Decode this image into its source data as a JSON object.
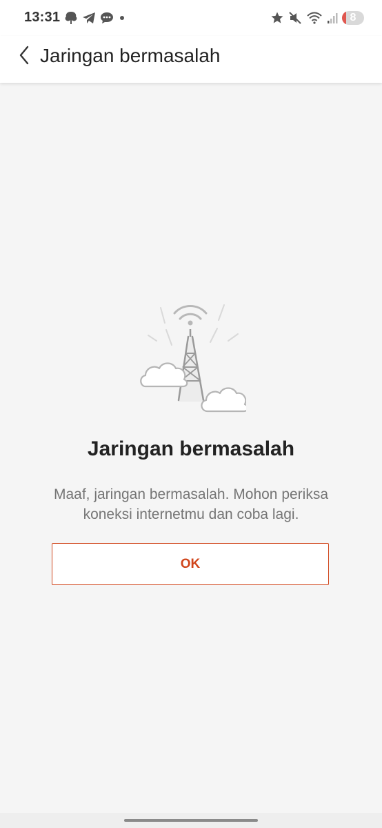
{
  "status_bar": {
    "time": "13:31",
    "left_icons": [
      "tree-notification-icon",
      "telegram-icon",
      "message-icon",
      "dot-icon"
    ],
    "right_icons": [
      "star-icon",
      "mute-icon",
      "wifi-icon",
      "signal-icon"
    ],
    "battery_level": "8",
    "battery_color": "#e0574f"
  },
  "header": {
    "title": "Jaringan bermasalah",
    "back_icon": "chevron-left-icon"
  },
  "error": {
    "illustration_icon": "signal-tower-icon",
    "title": "Jaringan bermasalah",
    "message": "Maaf, jaringan bermasalah. Mohon periksa koneksi internetmu dan coba lagi."
  },
  "actions": {
    "ok_label": "OK",
    "accent_color": "#d0451b"
  },
  "colors": {
    "background": "#f5f5f5",
    "header": "#ffffff"
  }
}
